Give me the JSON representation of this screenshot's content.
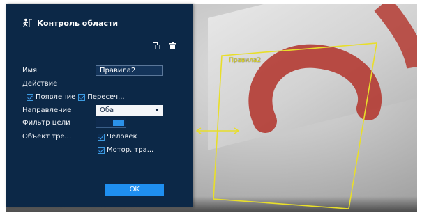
{
  "panel": {
    "title": "Контроль области",
    "tools": [
      "copy-icon",
      "delete-icon"
    ],
    "fields": {
      "name_label": "Имя",
      "name_value": "Правила2",
      "action_label": "Действие",
      "appear_label": "Появление",
      "appear_checked": true,
      "cross_label": "Пересеч...",
      "cross_checked": true,
      "direction_label": "Направление",
      "direction_value": "Оба",
      "filter_label": "Фильтр цели",
      "filter_on": true,
      "object_label": "Объект тре...",
      "human_label": "Человек",
      "human_checked": true,
      "motor_label": "Мотор. тра...",
      "motor_checked": true
    },
    "ok_label": "OK"
  },
  "overlay": {
    "rule_label": "Правила2",
    "line_color": "#e8de2a"
  },
  "colors": {
    "panel_bg": "#0c2847",
    "accent": "#1f8ff0",
    "checkbox": "#3d9be0"
  }
}
